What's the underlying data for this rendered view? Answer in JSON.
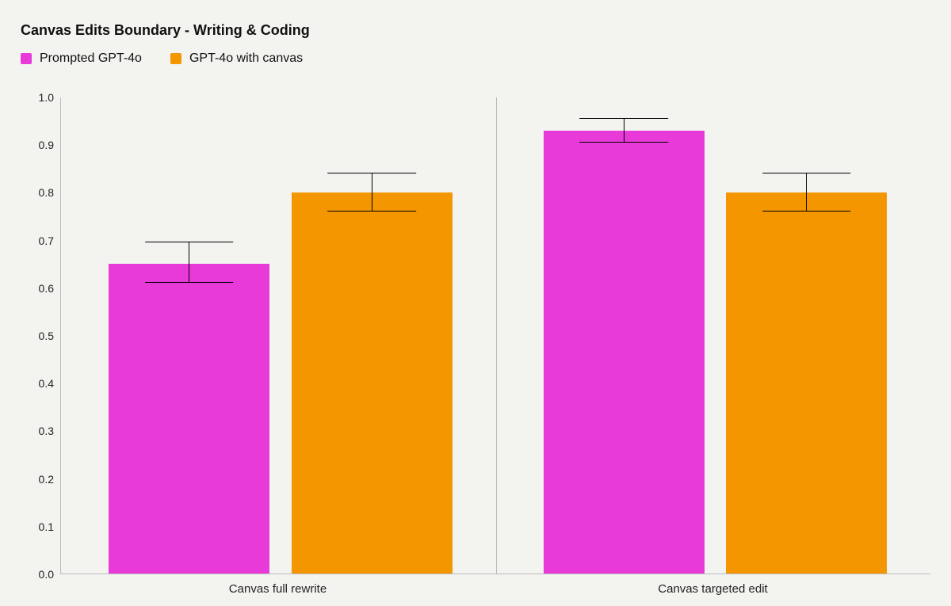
{
  "title": "Canvas Edits Boundary - Writing & Coding",
  "legend": {
    "items": [
      {
        "label": "Prompted GPT-4o",
        "color": "#e83ad8"
      },
      {
        "label": "GPT-4o with canvas",
        "color": "#f49600"
      }
    ]
  },
  "chart_data": {
    "type": "bar",
    "ylim": [
      0.0,
      1.0
    ],
    "yticks": [
      0.0,
      0.1,
      0.2,
      0.3,
      0.4,
      0.5,
      0.6,
      0.7,
      0.8,
      0.9,
      1.0
    ],
    "ytick_labels": [
      "0.0",
      "0.1",
      "0.2",
      "0.3",
      "0.4",
      "0.5",
      "0.6",
      "0.7",
      "0.8",
      "0.9",
      "1.0"
    ],
    "xlabel": "",
    "ylabel": "",
    "categories": [
      "Canvas full rewrite",
      "Canvas targeted edit"
    ],
    "series": [
      {
        "name": "Prompted GPT-4o",
        "color": "#e83ad8",
        "values": [
          0.65,
          0.93
        ],
        "err_low": [
          0.61,
          0.905
        ],
        "err_high": [
          0.695,
          0.955
        ]
      },
      {
        "name": "GPT-4o with canvas",
        "color": "#f49600",
        "values": [
          0.8,
          0.8
        ],
        "err_low": [
          0.76,
          0.76
        ],
        "err_high": [
          0.84,
          0.84
        ]
      }
    ],
    "layout": {
      "bar_width_pct": 18.5,
      "positions_pct": [
        [
          5.5,
          26.5
        ],
        [
          55.5,
          76.5
        ]
      ]
    }
  }
}
